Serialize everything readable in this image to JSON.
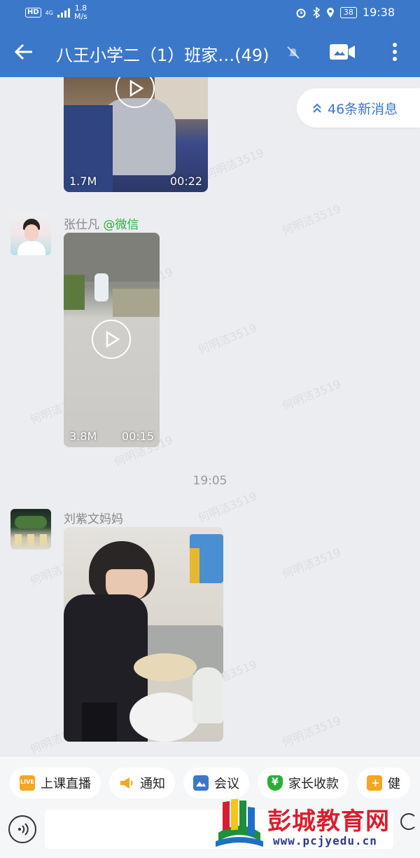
{
  "status_bar": {
    "hd": "HD",
    "net": "4G",
    "speed_value": "1.8",
    "speed_unit": "M/s",
    "battery": "38",
    "time": "19:38"
  },
  "title_bar": {
    "title": "八王小学二（1）班家…(49)"
  },
  "chat": {
    "new_messages": "46条新消息",
    "watermark": "何明洁3519",
    "messages": [
      {
        "video_size": "1.7M",
        "video_duration": "00:22"
      },
      {
        "sender": "张仕凡",
        "source": "@微信",
        "video_size": "3.8M",
        "video_duration": "00:15"
      },
      {
        "sender": "刘紫文妈妈"
      }
    ],
    "timestamp": "19:05"
  },
  "apps": [
    {
      "label": "上课直播",
      "icon": "live-icon",
      "color": "#f5a623",
      "badge": "LIVE"
    },
    {
      "label": "通知",
      "icon": "megaphone-icon",
      "color": "#f5a623"
    },
    {
      "label": "会议",
      "icon": "meeting-icon",
      "color": "#3b78c9"
    },
    {
      "label": "家长收款",
      "icon": "yuan-shield-icon",
      "color": "#2aae3a",
      "badge": "¥"
    },
    {
      "label": "健",
      "icon": "health-icon",
      "color": "#f5a623",
      "badge": "+"
    }
  ],
  "logo": {
    "name": "彭城教育网",
    "url": "www.pcjyedu.cn"
  },
  "colors": {
    "accent": "#3b78c9",
    "source_green": "#2aae3a",
    "logo_red": "#d81e2e"
  }
}
